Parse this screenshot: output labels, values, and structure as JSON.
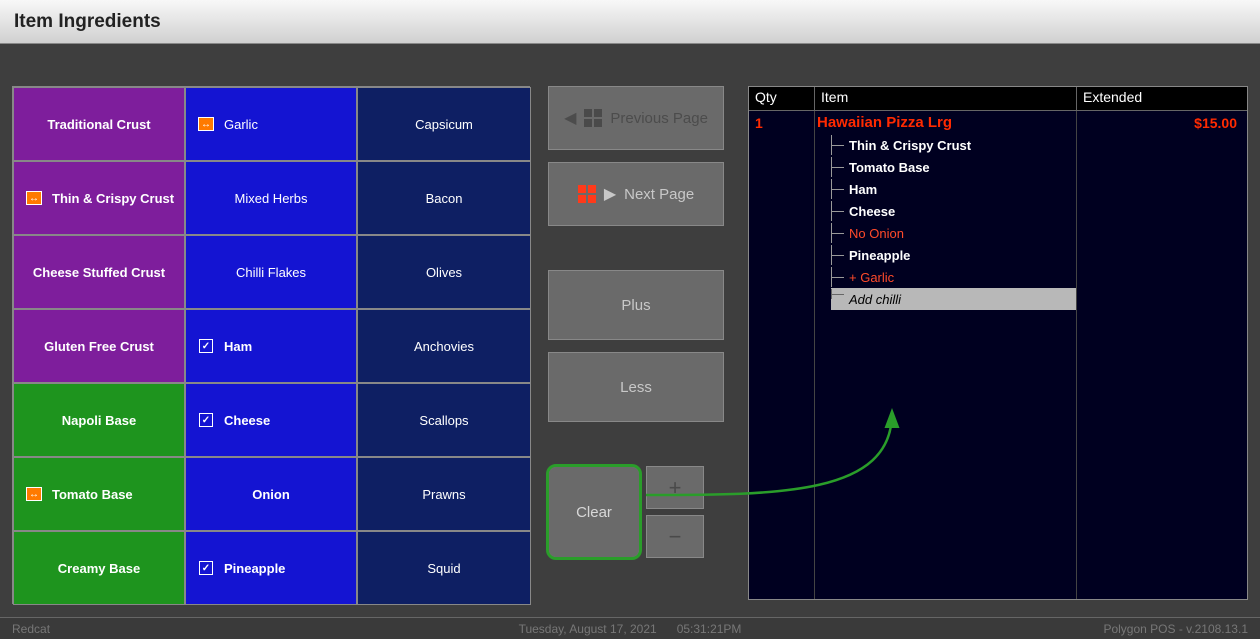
{
  "title": "Item Ingredients",
  "grid": {
    "rows": [
      [
        {
          "label": "Traditional Crust",
          "style": "purple",
          "mark": null,
          "bold": true,
          "align": "center"
        },
        {
          "label": "Garlic",
          "style": "blue",
          "mark": "swap",
          "bold": false,
          "align": "left"
        },
        {
          "label": "Capsicum",
          "style": "navy",
          "mark": null,
          "bold": false,
          "align": "center"
        }
      ],
      [
        {
          "label": "Thin & Crispy Crust",
          "style": "purple",
          "mark": "swap",
          "bold": true,
          "align": "left"
        },
        {
          "label": "Mixed Herbs",
          "style": "blue",
          "mark": null,
          "bold": false,
          "align": "center"
        },
        {
          "label": "Bacon",
          "style": "navy",
          "mark": null,
          "bold": false,
          "align": "center"
        }
      ],
      [
        {
          "label": "Cheese Stuffed Crust",
          "style": "purple",
          "mark": null,
          "bold": true,
          "align": "center"
        },
        {
          "label": "Chilli Flakes",
          "style": "blue",
          "mark": null,
          "bold": false,
          "align": "center"
        },
        {
          "label": "Olives",
          "style": "navy",
          "mark": null,
          "bold": false,
          "align": "center"
        }
      ],
      [
        {
          "label": "Gluten Free Crust",
          "style": "purple",
          "mark": null,
          "bold": true,
          "align": "center"
        },
        {
          "label": "Ham",
          "style": "blue",
          "mark": "tick",
          "bold": true,
          "align": "left"
        },
        {
          "label": "Anchovies",
          "style": "navy",
          "mark": null,
          "bold": false,
          "align": "center"
        }
      ],
      [
        {
          "label": "Napoli Base",
          "style": "green",
          "mark": null,
          "bold": true,
          "align": "center"
        },
        {
          "label": "Cheese",
          "style": "blue",
          "mark": "tick",
          "bold": true,
          "align": "left"
        },
        {
          "label": "Scallops",
          "style": "navy",
          "mark": null,
          "bold": false,
          "align": "center"
        }
      ],
      [
        {
          "label": "Tomato Base",
          "style": "green",
          "mark": "swap",
          "bold": true,
          "align": "left"
        },
        {
          "label": "Onion",
          "style": "blue",
          "mark": null,
          "bold": true,
          "align": "center"
        },
        {
          "label": "Prawns",
          "style": "navy",
          "mark": null,
          "bold": false,
          "align": "center"
        }
      ],
      [
        {
          "label": "Creamy Base",
          "style": "green",
          "mark": null,
          "bold": true,
          "align": "center"
        },
        {
          "label": "Pineapple",
          "style": "blue",
          "mark": "tick",
          "bold": true,
          "align": "left"
        },
        {
          "label": "Squid",
          "style": "navy",
          "mark": null,
          "bold": false,
          "align": "center"
        }
      ]
    ]
  },
  "controls": {
    "prev": "Previous Page",
    "next": "Next Page",
    "plus": "Plus",
    "less": "Less",
    "clear": "Clear",
    "inc": "+",
    "dec": "−"
  },
  "order": {
    "headers": {
      "qty": "Qty",
      "item": "Item",
      "ext": "Extended"
    },
    "qty": "1",
    "name": "Hawaiian Pizza Lrg",
    "price": "$15.00",
    "mods": [
      {
        "text": "Thin & Crispy Crust",
        "cls": "b"
      },
      {
        "text": "Tomato Base",
        "cls": "b"
      },
      {
        "text": "Ham",
        "cls": "b"
      },
      {
        "text": "Cheese",
        "cls": "b"
      },
      {
        "text": "No  Onion",
        "cls": "red"
      },
      {
        "text": "Pineapple",
        "cls": "b"
      },
      {
        "text": "+ Garlic",
        "cls": "red"
      },
      {
        "text": "Add chilli",
        "cls": "input"
      }
    ]
  },
  "status": {
    "left": "Redcat",
    "date": "Tuesday, August 17, 2021",
    "time": "05:31:21PM",
    "right": "Polygon POS - v.2108.13.1"
  }
}
